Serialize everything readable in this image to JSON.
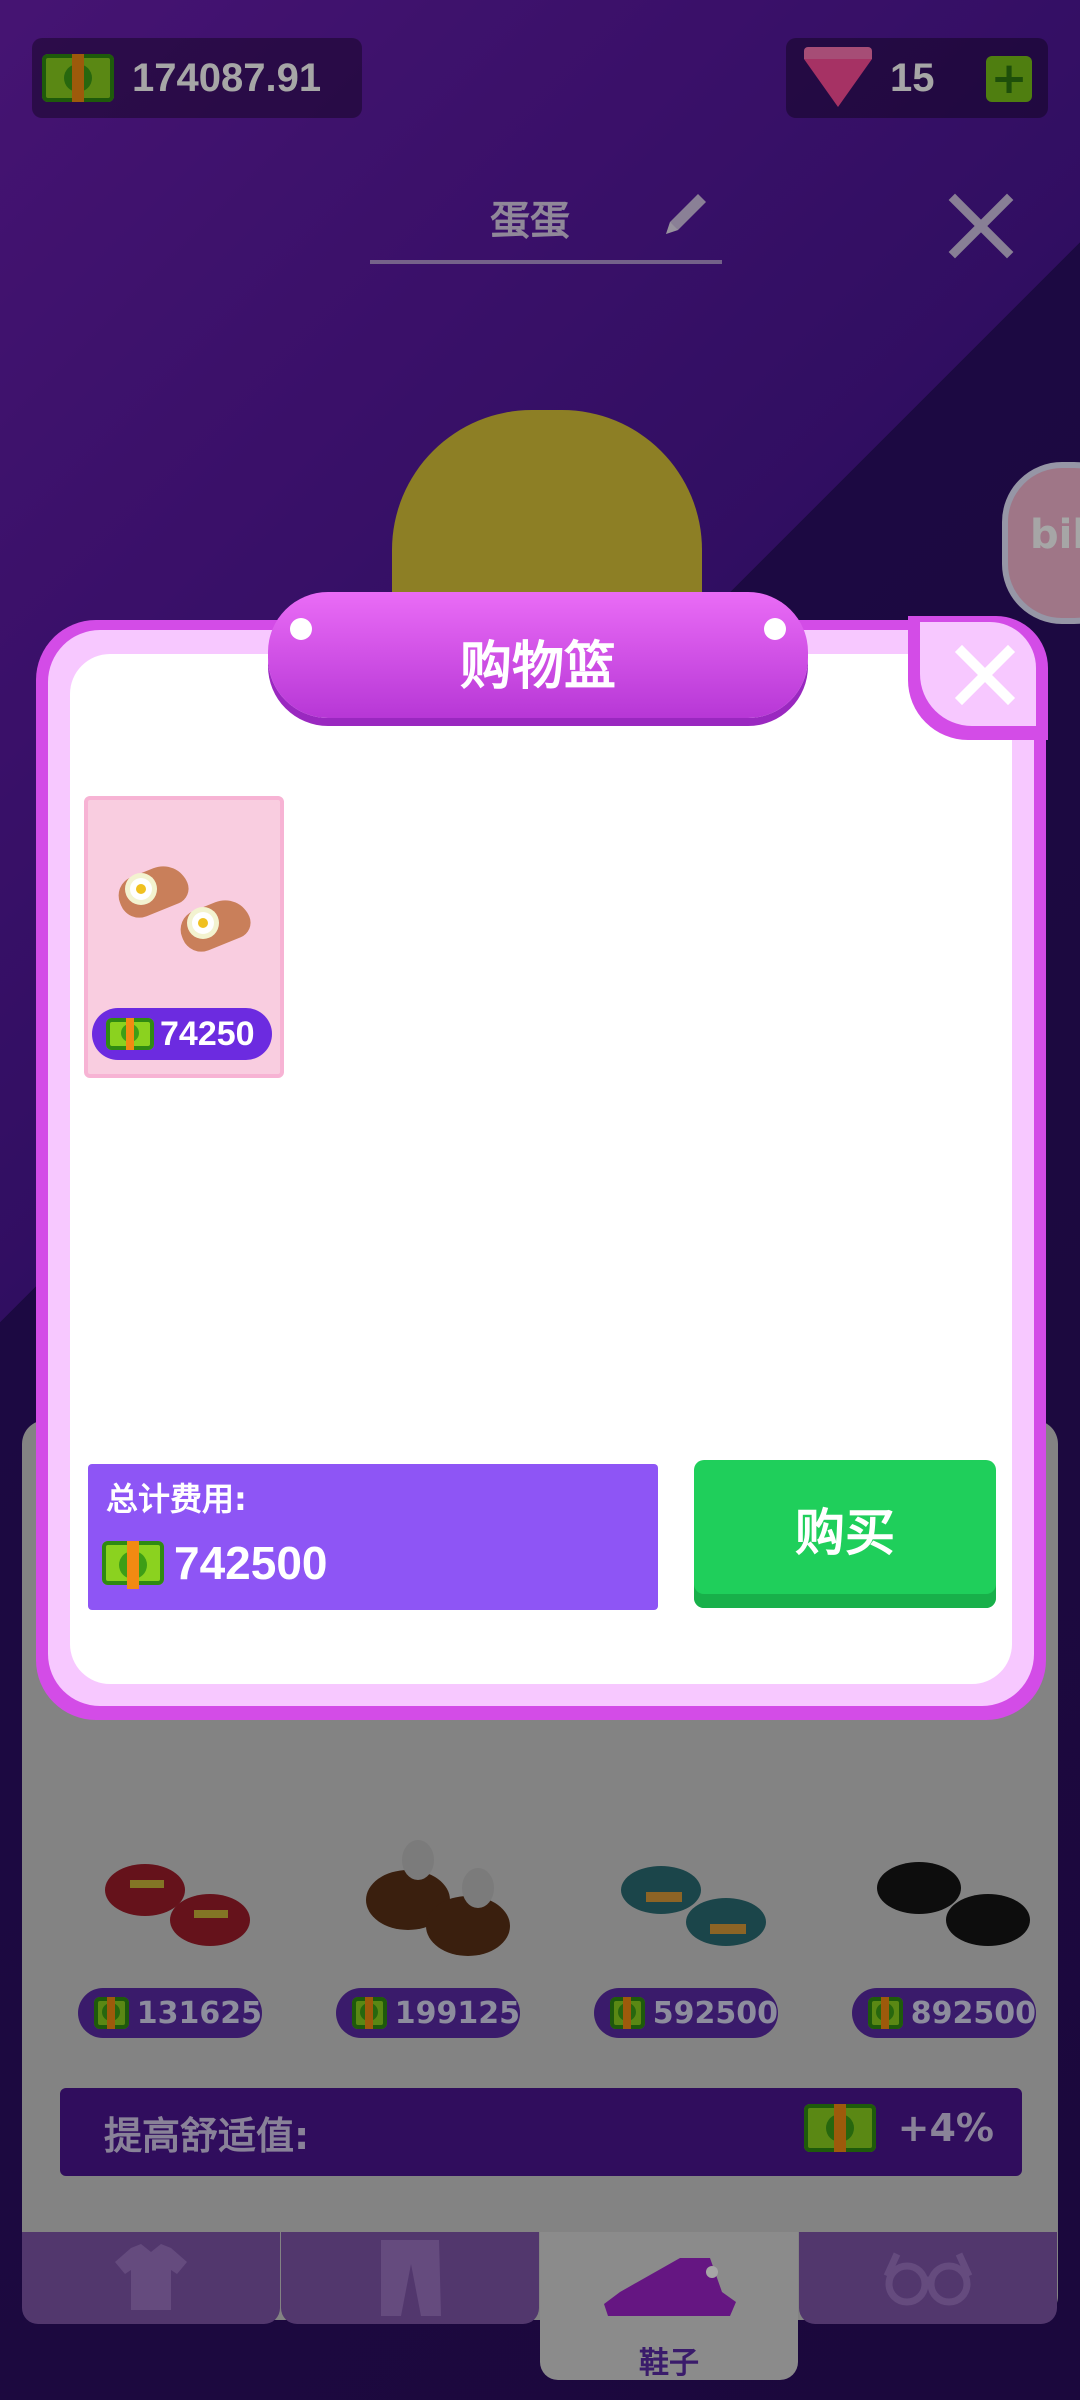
{
  "hud": {
    "money": "174087.91",
    "gems": "15",
    "icons": {
      "money": "cash-icon",
      "gems": "gem-icon",
      "add": "plus-icon"
    }
  },
  "profile": {
    "name": "蛋蛋",
    "edit_icon": "pencil-icon",
    "close_icon": "close-icon"
  },
  "shop_background": {
    "rows": [
      {
        "prices": [
          "131625",
          "199125",
          "592500",
          "892500"
        ]
      }
    ],
    "comfort_label": "提高舒适值:",
    "comfort_value": "+4%",
    "tabs": [
      {
        "name": "shirt",
        "icon": "shirt-icon",
        "label": ""
      },
      {
        "name": "pants",
        "icon": "pants-icon",
        "label": ""
      },
      {
        "name": "shoes",
        "icon": "shoe-icon",
        "label": "鞋子"
      },
      {
        "name": "glasses",
        "icon": "glasses-icon",
        "label": ""
      }
    ]
  },
  "basket": {
    "title": "购物篮",
    "close_icon": "close-icon",
    "items": [
      {
        "name": "sandals",
        "price": "74250"
      }
    ],
    "total_label": "总计费用:",
    "total_amount": "742500",
    "buy_label": "购买"
  },
  "colors": {
    "modal_border": "#d34ce7",
    "buy_button": "#1fcf5b",
    "total_box": "#8e55f5",
    "price_pill": "#6c2be0"
  }
}
